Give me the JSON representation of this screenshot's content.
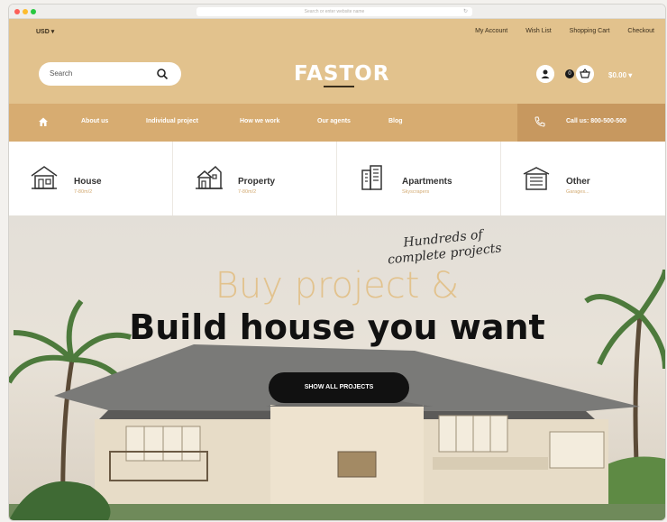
{
  "browser": {
    "url_text": "Search or enter website name"
  },
  "topbar": {
    "currency": "USD ▾",
    "links": [
      "My Account",
      "Wish List",
      "Shopping Cart",
      "Checkout"
    ]
  },
  "header": {
    "search_placeholder": "Search",
    "logo_a": "FA",
    "logo_b": "ST",
    "logo_c": "OR",
    "cart_count": "0",
    "cart_total": "$0.00 ▾"
  },
  "nav": {
    "items": [
      "About us",
      "Individual project",
      "How we work",
      "Our agents",
      "Blog"
    ],
    "call_text": "Call us: 800-500-500"
  },
  "categories": [
    {
      "name": "House",
      "sub": "7-80m/2"
    },
    {
      "name": "Property",
      "sub": "7-80m/2"
    },
    {
      "name": "Apartments",
      "sub": "Skyscrapers"
    },
    {
      "name": "Other",
      "sub": "Garages..."
    }
  ],
  "hero": {
    "handwritten_line1": "Hundreds of",
    "handwritten_line2": "complete projects",
    "headline_1": "Buy project &",
    "headline_2": "Build house you want",
    "cta": "SHOW ALL PROJECTS"
  },
  "colors": {
    "accent": "#e2c28d",
    "nav": "#d7ac71",
    "call": "#c7985f",
    "dark": "#111111"
  }
}
